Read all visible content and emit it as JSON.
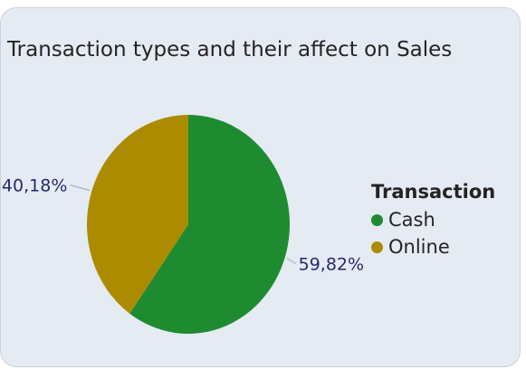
{
  "chart_data": {
    "type": "pie",
    "title": "Transaction types and their affect on Sales",
    "legend_title": "Transaction",
    "legend_position": "right",
    "series": [
      {
        "name": "Cash",
        "value": 59.82,
        "label": "59,82%",
        "color": "#1f8b31"
      },
      {
        "name": "Online",
        "value": 40.18,
        "label": "40,18%",
        "color": "#ad8b00"
      }
    ]
  },
  "colors": {
    "card_background": "#e4ebf3",
    "label_text": "#252a6b",
    "leader_line": "#b6bcc4"
  }
}
